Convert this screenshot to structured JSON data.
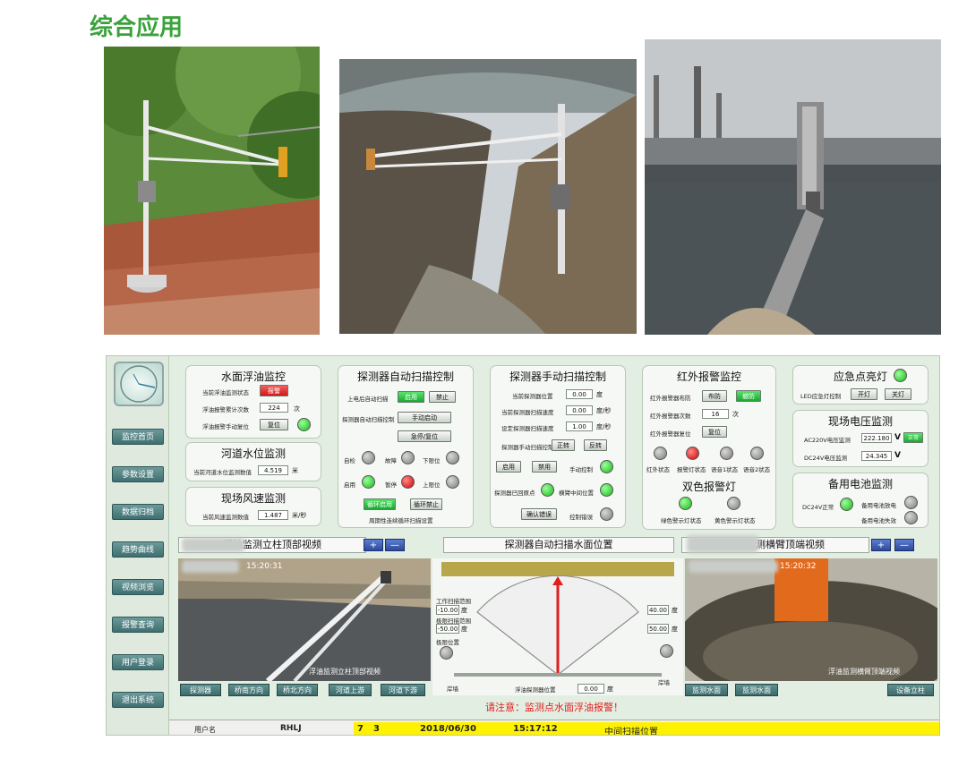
{
  "page_title": "综合应用",
  "nav": [
    "监控首页",
    "参数设置",
    "数据归档",
    "趋势曲线",
    "视频浏览",
    "报警查询",
    "用户登录",
    "退出系统"
  ],
  "oil": {
    "title": "水面浮油监控",
    "row1_label": "当前浮油监测状态",
    "row1_btn": "报警",
    "row2_label": "浮油报警累计次数",
    "row2_val": "224",
    "row2_unit": "次",
    "row3_label": "浮油报警手动复位",
    "row3_btn": "复位"
  },
  "water": {
    "title": "河道水位监测",
    "label": "当前河道水位监测数值",
    "value": "4.519",
    "unit": "米"
  },
  "wind": {
    "title": "现场风速监测",
    "label": "当前风速监测数值",
    "value": "1.487",
    "unit": "米/秒"
  },
  "auto_scan": {
    "title": "探测器自动扫描控制",
    "r1_label": "上电后自动扫描",
    "r1_btn1": "启用",
    "r1_btn2": "禁止",
    "r2_label": "探测器自动扫描控制",
    "r2_btn": "手动启动",
    "r3_btn": "急停/复位",
    "lamps": [
      "自检",
      "故障",
      "下限位",
      "启用",
      "暂停",
      "上限位"
    ],
    "b1": "循环启用",
    "b2": "循环禁止",
    "bottom_label": "周期性连续循环扫描设置"
  },
  "manual_scan": {
    "title": "探测器手动扫描控制",
    "rows": [
      {
        "label": "当前探测器位置",
        "value": "0.00",
        "unit": "度"
      },
      {
        "label": "当前探测器扫描速度",
        "value": "0.00",
        "unit": "度/秒"
      },
      {
        "label": "设定探测器扫描速度",
        "value": "1.00",
        "unit": "度/秒"
      }
    ],
    "dir_label": "探测器手动扫描控制",
    "fwd": "正转",
    "rev": "反转",
    "enable": "启用",
    "disable": "禁用",
    "manual_ctrl": "手动控制",
    "retracted": "探测器已回原点",
    "mid_pos": "横臂中间位置",
    "confirm": "确认错误",
    "ctrl_err": "控制错误"
  },
  "infrared": {
    "title": "红外报警监控",
    "r1_label": "红外报警器布防",
    "r1_btn1": "布防",
    "r1_btn2": "撤防",
    "r2_label": "红外报警器次数",
    "r2_val": "16",
    "r2_unit": "次",
    "r3_label": "红外报警器复位",
    "r3_btn": "复位",
    "lamp_labels": [
      "红外状态",
      "报警灯状态",
      "语音1状态",
      "语音2状态"
    ]
  },
  "dual_lamp": {
    "title": "双色报警灯",
    "green_label": "绿色警示灯状态",
    "yellow_label": "黄色警示灯状态"
  },
  "emergency": {
    "title": "应急点亮灯",
    "label": "LED应急灯控制",
    "on": "开灯",
    "off": "关灯"
  },
  "voltage": {
    "title": "现场电压监测",
    "ac_label": "AC220V电压监测",
    "ac_val": "222.180",
    "ac_unit": "V",
    "ac_status": "正常",
    "dc_label": "DC24V电压监测",
    "dc_val": "24.345",
    "dc_unit": "V"
  },
  "battery": {
    "title": "备用电池监测",
    "dc_label": "DC24V正常",
    "charge": "备用电池放电",
    "fault": "备用电池失效"
  },
  "video_left": {
    "title": "浮油监测立柱顶部视频",
    "plus": "+",
    "minus": "—",
    "time": "15:20:31",
    "caption": "浮油监测立柱顶部视频",
    "btns": [
      "探测器",
      "桥南方向",
      "桥北方向",
      "河道上游",
      "河道下游"
    ]
  },
  "video_mid": {
    "title": "探测器自动扫描水面位置",
    "work_label": "工作扫描范围",
    "work_val": "-10.00",
    "work_unit": "度",
    "limit_label": "极限扫描范围",
    "limit_val": "-50.00",
    "limit_unit": "度",
    "limit_pos": "极限位置",
    "right_val1": "40.00",
    "right_val2": "50.00",
    "right_unit": "度",
    "left_end": "岸墙",
    "right_end": "岸墙",
    "pos_label": "浮油探测器位置",
    "pos_val": "0.00",
    "pos_unit": "度"
  },
  "video_right": {
    "title": "浮油监测横臂顶端视频",
    "plus": "+",
    "minus": "—",
    "time": "15:20:32",
    "caption": "浮油监测横臂顶端视频",
    "btns": [
      "监测水面",
      "监测水面",
      "设备立柱"
    ]
  },
  "warning": "请注意：监测点水面浮油报警！",
  "status_bar": {
    "user_label": "用户名",
    "user": "RHLJ",
    "n1": "7",
    "n2": "3",
    "date": "2018/06/30",
    "time": "15:17:12",
    "scan_pos": "中间扫描位置"
  },
  "colors": {
    "title_green": "#3aa23a",
    "alarm_red": "#e01e1e",
    "lamp_green": "#19b819"
  }
}
